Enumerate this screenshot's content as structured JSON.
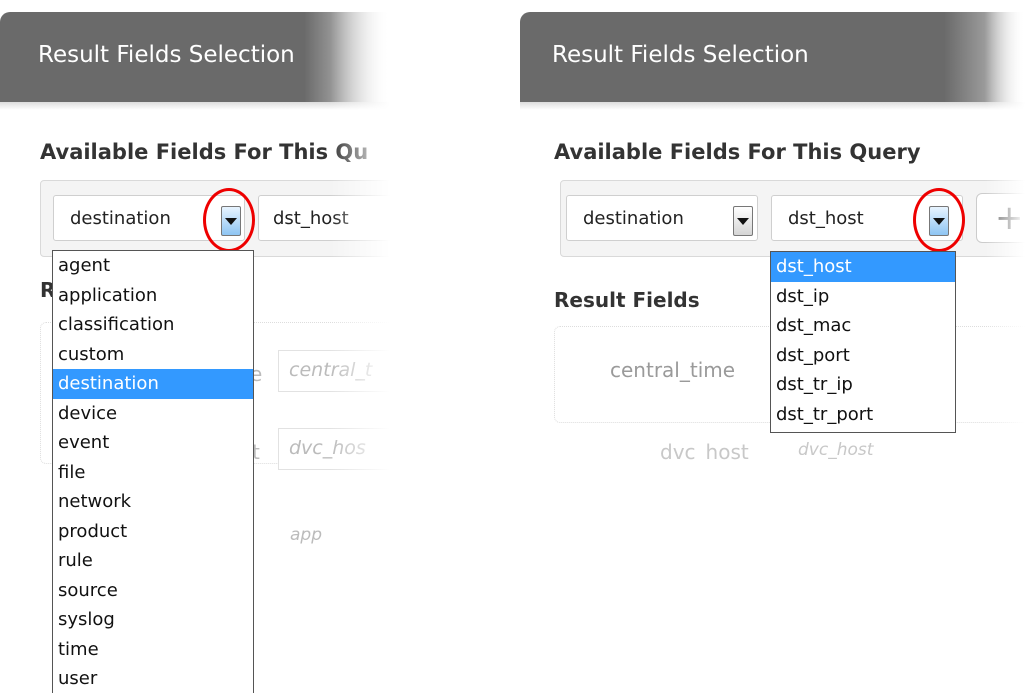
{
  "panel_title": "Result Fields Selection",
  "left": {
    "section_title": "Available Fields For This Qu",
    "category_value": "destination",
    "field_value": "dst_host",
    "category_options": [
      "agent",
      "application",
      "classification",
      "custom",
      "destination",
      "device",
      "event",
      "file",
      "network",
      "product",
      "rule",
      "source",
      "syslog",
      "time",
      "user"
    ],
    "selected_option": "destination",
    "result_fields_partial": "R",
    "ghost_names": [
      "e",
      "t",
      "app"
    ],
    "ghost_values": [
      "central_t",
      "dvc_hos"
    ]
  },
  "right": {
    "section_title": "Available Fields For This Query",
    "category_value": "destination",
    "field_value": "dst_host",
    "add_icon": "plus-icon",
    "result_fields_title": "Result Fields",
    "field_options": [
      "dst_host",
      "dst_ip",
      "dst_mac",
      "dst_port",
      "dst_tr_ip",
      "dst_tr_port"
    ],
    "selected_option": "dst_host",
    "ghost_name_1": "central_time",
    "ghost_name_2": "dvc_host",
    "ghost_value_2": "dvc_host"
  },
  "colors": {
    "header": "#6a6a6a",
    "selected": "#3399ff",
    "highlight_circle": "#ee0000"
  }
}
